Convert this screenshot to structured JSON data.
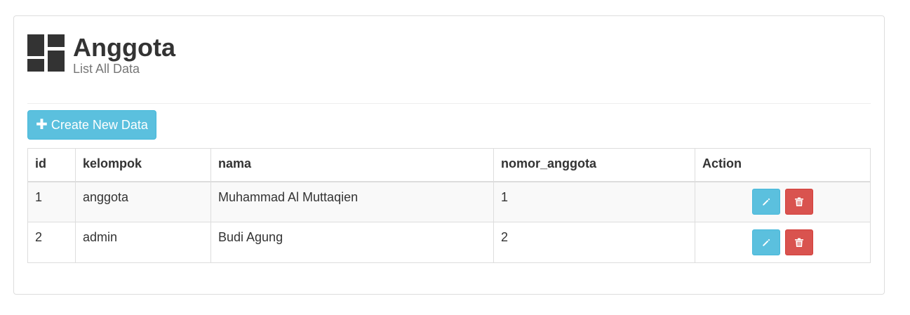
{
  "page": {
    "title": "Anggota",
    "subtitle": "List All Data",
    "icon": "dashboard-icon"
  },
  "toolbar": {
    "create_label": "Create New Data",
    "create_icon": "plus-icon"
  },
  "table": {
    "columns": [
      "id",
      "kelompok",
      "nama",
      "nomor_anggota",
      "Action"
    ],
    "rows": [
      {
        "id": "1",
        "kelompok": "anggota",
        "nama": "Muhammad Al Muttaqien",
        "nomor_anggota": "1"
      },
      {
        "id": "2",
        "kelompok": "admin",
        "nama": "Budi Agung",
        "nomor_anggota": "2"
      }
    ],
    "action_icons": [
      "pencil-icon",
      "trash-icon"
    ]
  },
  "colors": {
    "info": "#5bc0de",
    "danger": "#d9534f",
    "text": "#333333",
    "muted": "#777777"
  }
}
